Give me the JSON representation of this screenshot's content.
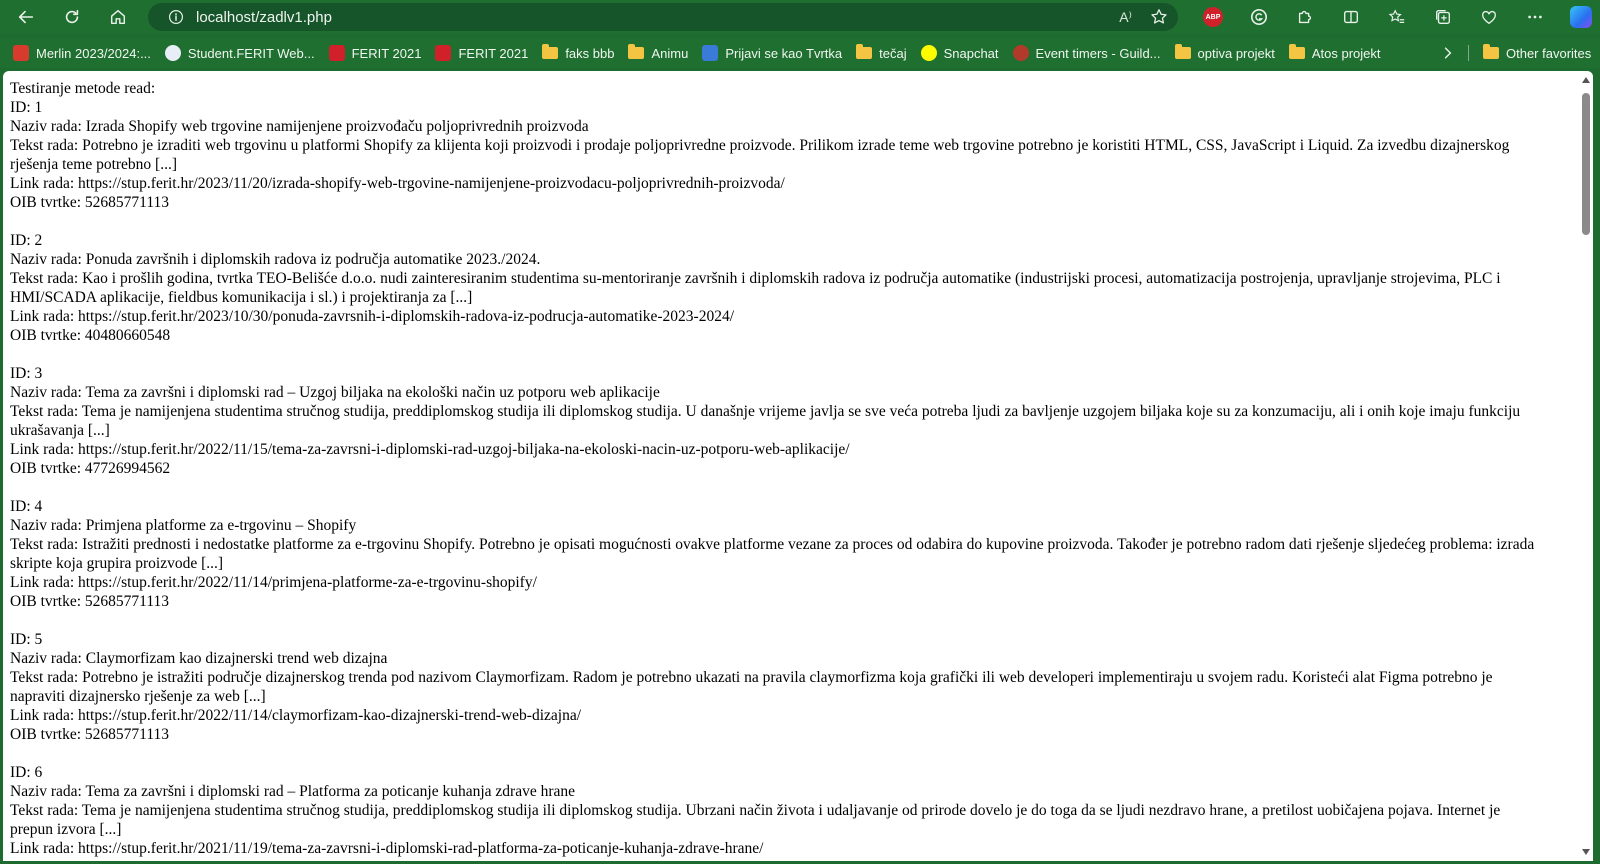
{
  "browser": {
    "url": "localhost/zadlv1.php",
    "read_aloud_label": "A⁾"
  },
  "bookmarks": [
    {
      "label": "Merlin 2023/2024:...",
      "icon": "merlin-icon",
      "color": "#d63b2e"
    },
    {
      "label": "Student.FERIT Web...",
      "icon": "ferit-student-icon",
      "color": "#e8eef7"
    },
    {
      "label": "FERIT 2021",
      "icon": "ferit-flag-icon",
      "color": "#d0202a"
    },
    {
      "label": "FERIT 2021",
      "icon": "ferit-flag-icon",
      "color": "#d0202a"
    },
    {
      "label": "faks bbb",
      "icon": "folder-icon",
      "color": "#f4c542"
    },
    {
      "label": "Animu",
      "icon": "folder-icon",
      "color": "#f4c542"
    },
    {
      "label": "Prijavi se kao Tvrtka",
      "icon": "chart-icon",
      "color": "#3b7bd8"
    },
    {
      "label": "tečaj",
      "icon": "folder-icon",
      "color": "#f4c542"
    },
    {
      "label": "Snapchat",
      "icon": "snapchat-icon",
      "color": "#fffc00"
    },
    {
      "label": "Event timers - Guild...",
      "icon": "guild-icon",
      "color": "#b23a2a"
    },
    {
      "label": "optiva projekt",
      "icon": "folder-icon",
      "color": "#f4c542"
    },
    {
      "label": "Atos projekt",
      "icon": "folder-icon",
      "color": "#f4c542"
    }
  ],
  "other_favorites": "Other favorites",
  "page": {
    "heading": "Testiranje metode read:",
    "records": [
      {
        "id": "ID: 1",
        "naziv": "Naziv rada: Izrada Shopify web trgovine namijenjene proizvođaču poljoprivrednih proizvoda",
        "tekst": "Tekst rada: Potrebno je izraditi web trgovinu u platformi Shopify za klijenta koji proizvodi i prodaje poljoprivredne proizvode. Prilikom izrade teme web trgovine potrebno je koristiti HTML, CSS, JavaScript i Liquid. Za izvedbu dizajnerskog rješenja teme potrebno [...]",
        "link": "Link rada: https://stup.ferit.hr/2023/11/20/izrada-shopify-web-trgovine-namijenjene-proizvodacu-poljoprivrednih-proizvoda/",
        "oib": "OIB tvrtke: 52685771113"
      },
      {
        "id": "ID: 2",
        "naziv": "Naziv rada: Ponuda završnih i diplomskih radova iz područja automatike 2023./2024.",
        "tekst": "Tekst rada: Kao i prošlih godina, tvrtka TEO-Belišće d.o.o. nudi zainteresiranim studentima su-mentoriranje završnih i diplomskih radova iz područja automatike (industrijski procesi, automatizacija postrojenja, upravljanje strojevima, PLC i HMI/SCADA aplikacije, fieldbus komunikacija i sl.) i projektiranja za [...]",
        "link": "Link rada: https://stup.ferit.hr/2023/10/30/ponuda-zavrsnih-i-diplomskih-radova-iz-podrucja-automatike-2023-2024/",
        "oib": "OIB tvrtke: 40480660548"
      },
      {
        "id": "ID: 3",
        "naziv": "Naziv rada: Tema za završni i diplomski rad – Uzgoj biljaka na ekološki način uz potporu web aplikacije",
        "tekst": "Tekst rada: Tema je namijenjena studentima stručnog studija, preddiplomskog studija ili diplomskog studija. U današnje vrijeme javlja se sve veća potreba ljudi za bavljenje uzgojem biljaka koje su za konzumaciju, ali i onih koje imaju funkciju ukrašavanja [...]",
        "link": "Link rada: https://stup.ferit.hr/2022/11/15/tema-za-zavrsni-i-diplomski-rad-uzgoj-biljaka-na-ekoloski-nacin-uz-potporu-web-aplikacije/",
        "oib": "OIB tvrtke: 47726994562"
      },
      {
        "id": "ID: 4",
        "naziv": "Naziv rada: Primjena platforme za e-trgovinu – Shopify",
        "tekst": "Tekst rada: Istražiti prednosti i nedostatke platforme za e-trgovinu Shopify. Potrebno je opisati mogućnosti ovakve platforme vezane za proces od odabira do kupovine proizvoda. Također je potrebno radom dati rješenje sljedećeg problema: izrada skripte koja grupira proizvode [...]",
        "link": "Link rada: https://stup.ferit.hr/2022/11/14/primjena-platforme-za-e-trgovinu-shopify/",
        "oib": "OIB tvrtke: 52685771113"
      },
      {
        "id": "ID: 5",
        "naziv": "Naziv rada: Claymorfizam kao dizajnerski trend web dizajna",
        "tekst": "Tekst rada: Potrebno je istražiti područje dizajnerskog trenda pod nazivom Claymorfizam. Radom je potrebno ukazati na pravila claymorfizma koja grafički ili web developeri implementiraju u svojem radu. Koristeći alat Figma potrebno je napraviti dizajnersko rješenje za web [...]",
        "link": "Link rada: https://stup.ferit.hr/2022/11/14/claymorfizam-kao-dizajnerski-trend-web-dizajna/",
        "oib": "OIB tvrtke: 52685771113"
      },
      {
        "id": "ID: 6",
        "naziv": "Naziv rada: Tema za završni i diplomski rad – Platforma za poticanje kuhanja zdrave hrane",
        "tekst": "Tekst rada: Tema je namijenjena studentima stručnog studija, preddiplomskog studija ili diplomskog studija. Ubrzani način života i udaljavanje od prirode dovelo je do toga da se ljudi nezdravo hrane, a pretilost uobičajena pojava. Internet je prepun izvora [...]",
        "link": "Link rada: https://stup.ferit.hr/2021/11/19/tema-za-zavrsni-i-diplomski-rad-platforma-za-poticanje-kuhanja-zdrave-hrane/",
        "oib": ""
      }
    ]
  },
  "colors": {
    "frame": "#1f6f30",
    "address_bg": "#16542a",
    "page_bg": "#ffffff",
    "abp": "#d0202a"
  }
}
